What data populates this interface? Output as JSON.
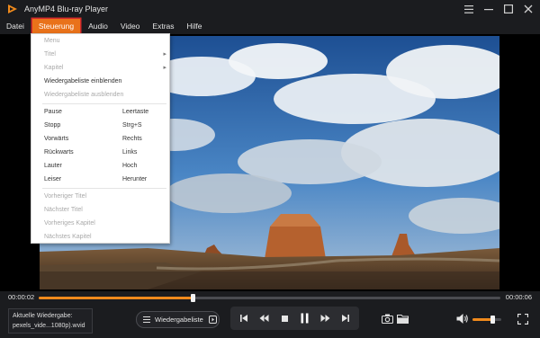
{
  "window": {
    "title": "AnyMP4 Blu-ray Player",
    "icons": [
      "app-logo-icon",
      "menu-icon",
      "minimize-icon",
      "maximize-icon",
      "close-icon"
    ]
  },
  "menubar": {
    "items": [
      "Datei",
      "Steuerung",
      "Audio",
      "Video",
      "Extras",
      "Hilfe"
    ],
    "active": "Steuerung",
    "active_color": "#e9721a"
  },
  "dropdown": {
    "items": [
      {
        "label": "Menu",
        "shortcut": "",
        "disabled": true,
        "submenu": false
      },
      {
        "label": "Titel",
        "shortcut": "",
        "disabled": true,
        "submenu": true
      },
      {
        "label": "Kapitel",
        "shortcut": "",
        "disabled": true,
        "submenu": true
      },
      {
        "label": "Wiedergabeliste einblenden",
        "shortcut": "",
        "disabled": false,
        "submenu": false
      },
      {
        "label": "Wiedergabeliste ausblenden",
        "shortcut": "",
        "disabled": true,
        "submenu": false
      },
      {
        "label": "Pause",
        "shortcut": "Leertaste",
        "disabled": false,
        "submenu": false
      },
      {
        "label": "Stopp",
        "shortcut": "Strg+S",
        "disabled": false,
        "submenu": false
      },
      {
        "label": "Vorwärts",
        "shortcut": "Rechts",
        "disabled": false,
        "submenu": false
      },
      {
        "label": "Rückwarts",
        "shortcut": "Links",
        "disabled": false,
        "submenu": false
      },
      {
        "label": "Lauter",
        "shortcut": "Hoch",
        "disabled": false,
        "submenu": false
      },
      {
        "label": "Leiser",
        "shortcut": "Herunter",
        "disabled": false,
        "submenu": false
      },
      {
        "label": "Vorheriger Titel",
        "shortcut": "",
        "disabled": true,
        "submenu": false
      },
      {
        "label": "Nächster Titel",
        "shortcut": "",
        "disabled": true,
        "submenu": false
      },
      {
        "label": "Vorheriges Kapitel",
        "shortcut": "",
        "disabled": true,
        "submenu": false
      },
      {
        "label": "Nächstes Kapitel",
        "shortcut": "",
        "disabled": true,
        "submenu": false
      }
    ]
  },
  "playback": {
    "current_time": "00:00:02",
    "total_time": "00:00:06",
    "progress": 0.333,
    "accent_color": "#f08a1c"
  },
  "now_playing": {
    "label": "Aktuelle Wiedergabe:",
    "file": "pexels_vide...1080p).wvid"
  },
  "playlist_button": {
    "label": "Wiedergabeliste"
  },
  "transport": {
    "icons": [
      "skip-start-icon",
      "rewind-icon",
      "stop-icon",
      "pause-icon",
      "fast-forward-icon",
      "skip-end-icon"
    ]
  },
  "tools": {
    "icons": [
      "snapshot-camera-icon",
      "open-folder-icon",
      "volume-icon",
      "fullscreen-icon"
    ]
  },
  "volume": {
    "level": 0.7
  }
}
